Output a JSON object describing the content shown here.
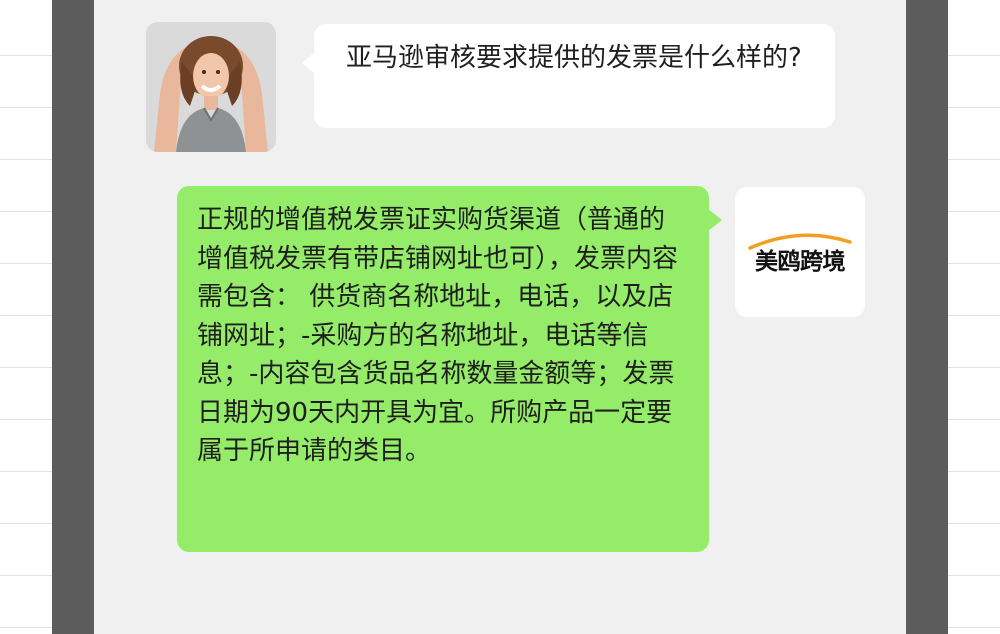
{
  "conversation": {
    "incoming": {
      "avatar_icon": "woman-photo-avatar",
      "text": "亚马逊审核要求提供的发票是什么样的?"
    },
    "outgoing": {
      "avatar_icon": "brand-logo-avatar",
      "text": "正规的增值税发票证实购货渠道（普通的增值税发票有带店铺网址也可），发票内容需包含： 供货商名称地址，电话，以及店铺网址；-采购方的名称地址，电话等信息；-内容包含货品名称数量金额等；发票日期为90天内开具为宜。所购产品一定要属于所申请的类目。"
    },
    "brand": {
      "name": "美鸥跨境",
      "accent_color": "#f0a020"
    }
  },
  "colors": {
    "chat_background": "#f0f0f0",
    "incoming_bubble": "#ffffff",
    "outgoing_bubble": "#95ec69",
    "frame": "#5c5c5c"
  }
}
